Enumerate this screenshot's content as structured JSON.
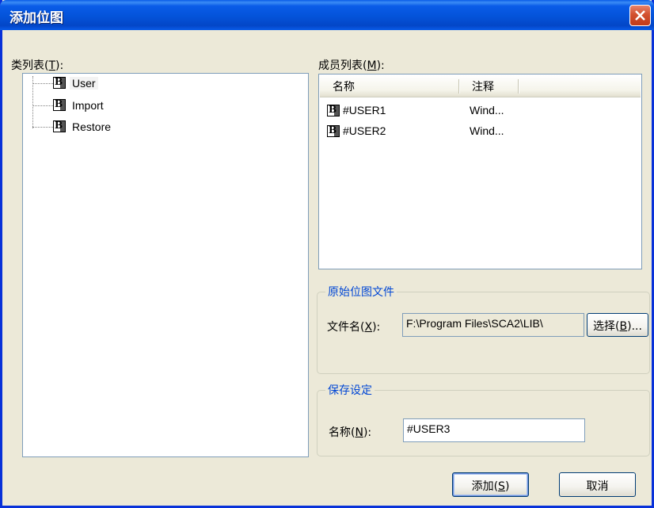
{
  "window": {
    "title": "添加位图"
  },
  "class_list": {
    "label": "类列表",
    "accel": "T",
    "items": [
      {
        "label": "User",
        "selected": true
      },
      {
        "label": "Import"
      },
      {
        "label": "Restore"
      }
    ]
  },
  "member_list": {
    "label": "成员列表",
    "accel": "M",
    "columns": [
      "名称",
      "注释"
    ],
    "rows": [
      {
        "name": "#USER1",
        "comment": "Wind..."
      },
      {
        "name": "#USER2",
        "comment": "Wind..."
      }
    ]
  },
  "source_bitmap": {
    "group_title": "原始位图文件",
    "filename_label": "文件名",
    "filename_accel": "X",
    "filename_value": "F:\\Program Files\\SCA2\\LIB\\",
    "browse_label": "选择",
    "browse_accel": "B"
  },
  "save_settings": {
    "group_title": "保存设定",
    "name_label": "名称",
    "name_accel": "N",
    "name_value": "#USER3"
  },
  "buttons": {
    "add_label": "添加",
    "add_accel": "S",
    "cancel_label": "取消"
  },
  "icons": {
    "close": "close-icon",
    "class": "bitmap-b-icon"
  },
  "colors": {
    "titlebar": "#0a5ce8",
    "group_title": "#0046d5",
    "close": "#d2502f"
  }
}
